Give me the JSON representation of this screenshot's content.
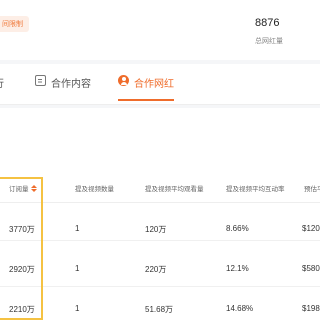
{
  "header": {
    "badge_text": "间限制",
    "stat_value": "8876",
    "stat_label": "总网红量"
  },
  "tabs": [
    {
      "label": "行",
      "icon": "none"
    },
    {
      "label": "合作内容",
      "icon": "content-icon"
    },
    {
      "label": "合作网红",
      "icon": "person-icon",
      "active": true
    }
  ],
  "table": {
    "columns": [
      "订阅量",
      "提及视频数量",
      "提及视频平均观看量",
      "提及视频平均互动率",
      "预估平"
    ],
    "sort_column": "订阅量",
    "rows": [
      [
        "3770万",
        "1",
        "120万",
        "8.66%",
        "$120"
      ],
      [
        "2920万",
        "1",
        "220万",
        "12.1%",
        "$580"
      ],
      [
        "2210万",
        "1",
        "51.68万",
        "14.68%",
        "$198"
      ]
    ]
  },
  "colors": {
    "accent": "#ef6c2b",
    "highlight": "#f5c242"
  }
}
